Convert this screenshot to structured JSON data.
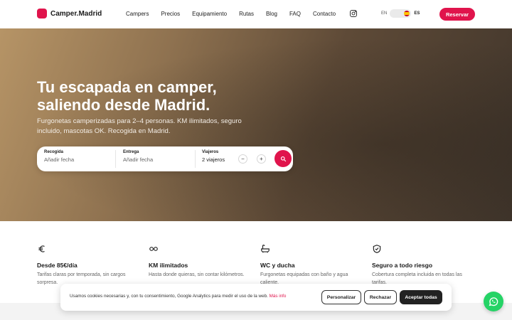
{
  "header": {
    "logo_text": "Camper.Madrid",
    "nav": [
      "Campers",
      "Precios",
      "Equipamiento",
      "Rutas",
      "Blog",
      "FAQ",
      "Contacto"
    ],
    "lang_en": "EN",
    "lang_es": "ES",
    "reserve_label": "Reservar"
  },
  "hero": {
    "title": "Tu escapada en camper, saliendo desde Madrid.",
    "subtitle": "Furgonetas camperizadas para 2–4 personas. KM ilimitados, seguro incluido, mascotas OK. Recogida en Madrid.",
    "booking": {
      "pickup_label": "Recogida",
      "pickup_value": "Añadir fecha",
      "return_label": "Entrega",
      "return_value": "Añadir fecha",
      "travelers_label": "Viajeros",
      "travelers_value": "2 viajeros",
      "minus": "−",
      "plus": "+"
    }
  },
  "features": [
    {
      "icon": "euro-icon",
      "title": "Desde 85€/día",
      "text": "Tarifas claras por temporada, sin cargos sorpresa."
    },
    {
      "icon": "infinity-icon",
      "title": "KM ilimitados",
      "text": "Hasta donde quieras, sin contar kilómetros."
    },
    {
      "icon": "bath-icon",
      "title": "WC y ducha",
      "text": "Furgonetas equipadas con baño y agua caliente."
    },
    {
      "icon": "shield-icon",
      "title": "Seguro a todo riesgo",
      "text": "Cobertura completa incluida en todas las tarifas."
    }
  ],
  "cookie": {
    "text": "Usamos cookies necesarias y, con tu consentimiento, Google Analytics para medir el uso de la web.",
    "more": "Más info",
    "customize": "Personalizar",
    "reject": "Rechazar",
    "accept": "Aceptar todas"
  },
  "colors": {
    "accent": "#e0144c",
    "whatsapp": "#25d366"
  }
}
